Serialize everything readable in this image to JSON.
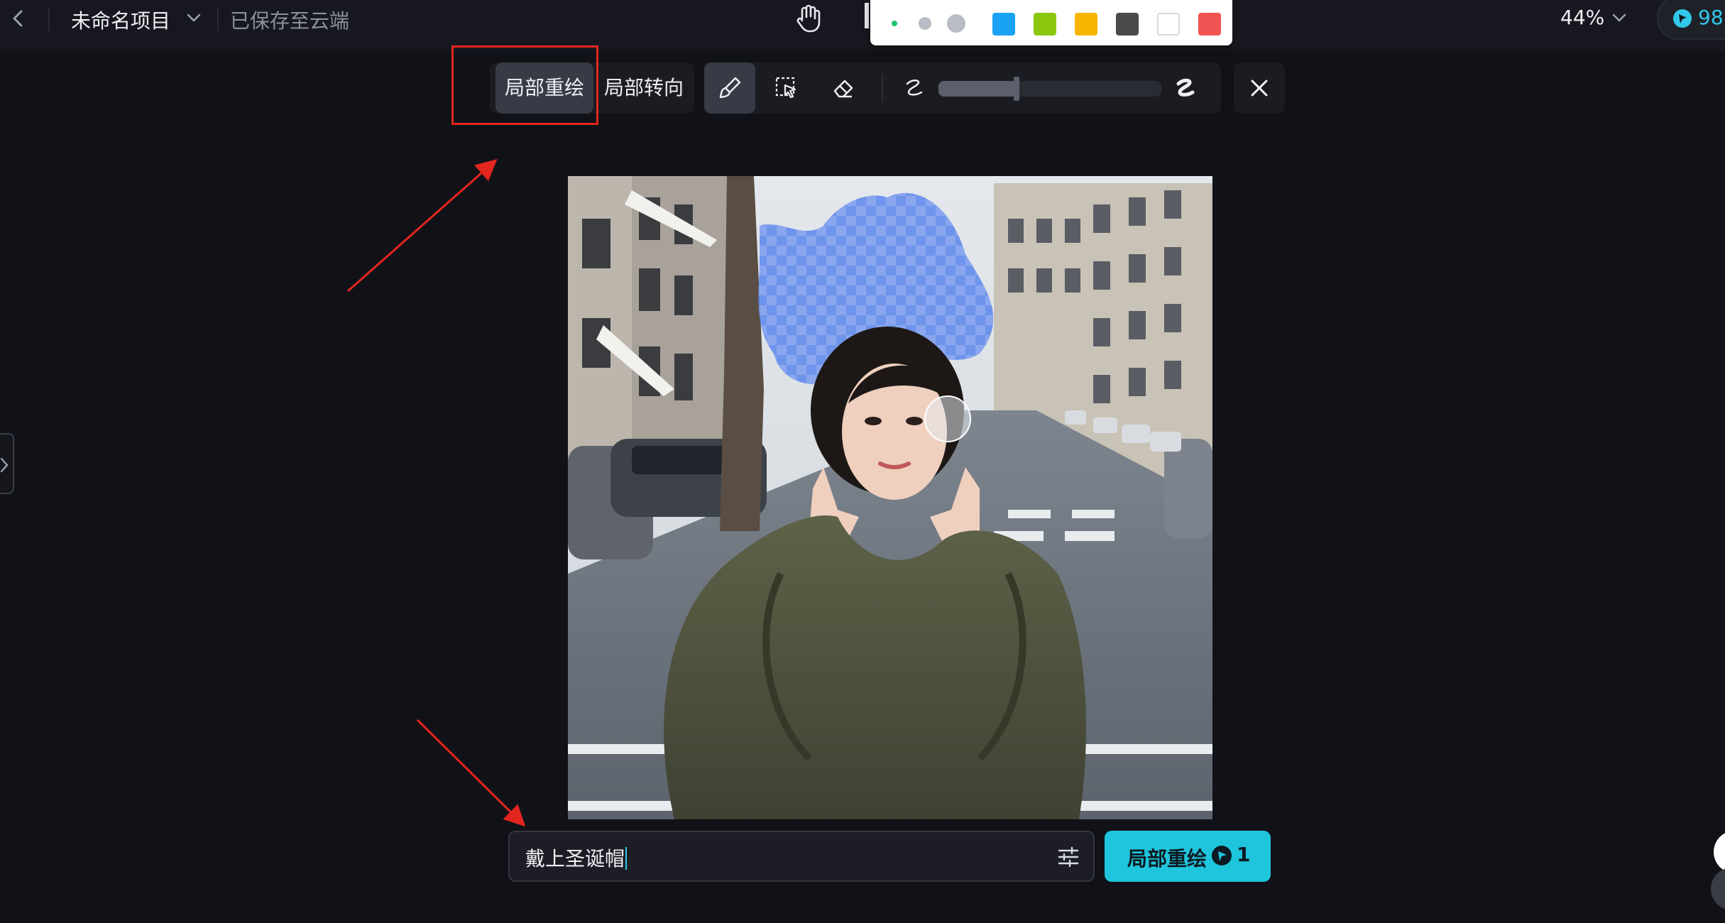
{
  "header": {
    "project_name": "未命名项目",
    "save_status": "已保存至云端",
    "zoom": "44%",
    "credits": "98"
  },
  "palette": {
    "brush_sizes": [
      "small",
      "medium",
      "large"
    ],
    "colors": [
      "#1aa3f5",
      "#8bc70f",
      "#f7b500",
      "#4a4a4a",
      "#ffffff",
      "#f25353"
    ],
    "brush_dot_colors": [
      "#1fc26a",
      "#b8bcc4",
      "#b8bcc4"
    ]
  },
  "toolbar": {
    "modes": [
      {
        "label": "局部重绘",
        "active": true
      },
      {
        "label": "局部转向",
        "active": false
      }
    ],
    "tools": [
      "brush-icon",
      "smart-select-icon",
      "eraser-icon"
    ],
    "brush_size_fraction": 0.35,
    "close_icon": "close-icon"
  },
  "prompt": {
    "value": "戴上圣诞帽",
    "submit_label": "局部重绘",
    "cost": "1"
  },
  "colors": {
    "accent": "#1fc5dc",
    "annotation": "#e2251e",
    "mask": "#4f7ff0"
  }
}
